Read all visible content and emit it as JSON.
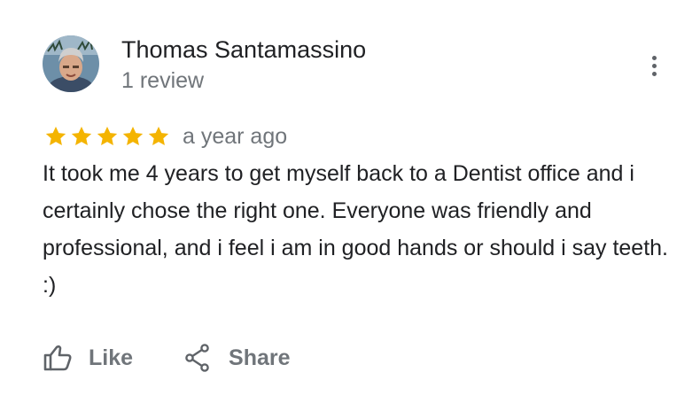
{
  "review": {
    "author": {
      "name": "Thomas Santamassino",
      "review_count": "1 review",
      "avatar_icon": "user-photo-avatar"
    },
    "rating": 5,
    "rating_max": 5,
    "star_icon": "star-icon",
    "star_color": "#F4B400",
    "date": "a year ago",
    "text": "It took me 4 years to get myself back to a Dentist office and i certainly chose the right one. Everyone was friendly and professional, and i feel i am in good hands or should i say teeth. :)",
    "menu_icon": "more-vert-icon"
  },
  "actions": {
    "like": {
      "label": "Like",
      "icon": "thumb-up-icon"
    },
    "share": {
      "label": "Share",
      "icon": "share-icon"
    }
  },
  "colors": {
    "text_primary": "#202124",
    "text_secondary": "#70757a",
    "icon_gray": "#5f6368"
  }
}
